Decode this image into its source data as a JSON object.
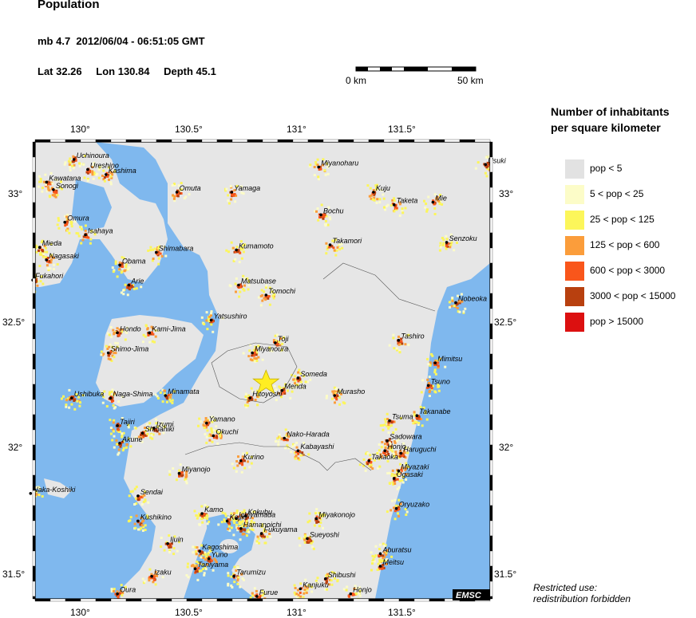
{
  "title": "Population",
  "event": {
    "magnitude": "mb 4.7",
    "datetime": "2012/06/04 - 06:51:05 GMT"
  },
  "location": {
    "lat": "Lat 32.26",
    "lon": "Lon 130.84",
    "depth": "Depth  45.1"
  },
  "scale": {
    "start": "0 km",
    "end": "50 km"
  },
  "legend": {
    "title_line1": "Number of inhabitants",
    "title_line2": "per square kilometer",
    "classes": [
      {
        "label": "pop < 5",
        "color": "#e2e2e2"
      },
      {
        "label": "5 < pop < 25",
        "color": "#fcfcc8"
      },
      {
        "label": "25 < pop < 125",
        "color": "#fcf65a"
      },
      {
        "label": "125 < pop < 600",
        "color": "#fb9d3b"
      },
      {
        "label": "600 < pop < 3000",
        "color": "#f9561b"
      },
      {
        "label": "3000 < pop < 15000",
        "color": "#b8400f"
      },
      {
        "label": "pop > 15000",
        "color": "#dc1010"
      }
    ]
  },
  "axes": {
    "lon_ticks": [
      "130°",
      "130.5°",
      "131°",
      "131.5°"
    ],
    "lat_ticks": [
      "33°",
      "32.5°",
      "32°",
      "31.5°"
    ]
  },
  "epicenter": {
    "lat": 32.26,
    "lon": 130.84,
    "color": "#ffee22"
  },
  "cities": [
    {
      "name": "Uchinoura",
      "lon": 130.0,
      "lat": 33.15
    },
    {
      "name": "Ureshino",
      "lon": 130.06,
      "lat": 33.11
    },
    {
      "name": "Kashima",
      "lon": 130.14,
      "lat": 33.09
    },
    {
      "name": "Kawatana",
      "lon": 129.88,
      "lat": 33.06
    },
    {
      "name": "Sonogi",
      "lon": 129.91,
      "lat": 33.03
    },
    {
      "name": "Omuta",
      "lon": 130.45,
      "lat": 33.02
    },
    {
      "name": "Yamaga",
      "lon": 130.69,
      "lat": 33.02
    },
    {
      "name": "Miyanoharu",
      "lon": 131.07,
      "lat": 33.12
    },
    {
      "name": "Kuju",
      "lon": 131.31,
      "lat": 33.02
    },
    {
      "name": "Taketa",
      "lon": 131.4,
      "lat": 32.97
    },
    {
      "name": "Mie",
      "lon": 131.57,
      "lat": 32.98
    },
    {
      "name": "Usuki",
      "lon": 131.8,
      "lat": 33.13
    },
    {
      "name": "Omura",
      "lon": 129.96,
      "lat": 32.9
    },
    {
      "name": "Isahaya",
      "lon": 130.05,
      "lat": 32.85
    },
    {
      "name": "Bochu",
      "lon": 131.08,
      "lat": 32.93
    },
    {
      "name": "Senzoku",
      "lon": 131.63,
      "lat": 32.82
    },
    {
      "name": "Mieda",
      "lon": 129.85,
      "lat": 32.8
    },
    {
      "name": "Takamori",
      "lon": 131.12,
      "lat": 32.81
    },
    {
      "name": "Shimabara",
      "lon": 130.36,
      "lat": 32.78
    },
    {
      "name": "Kumamoto",
      "lon": 130.71,
      "lat": 32.79
    },
    {
      "name": "Nagasaki",
      "lon": 129.88,
      "lat": 32.75
    },
    {
      "name": "Obama",
      "lon": 130.2,
      "lat": 32.73
    },
    {
      "name": "Arie",
      "lon": 130.24,
      "lat": 32.65
    },
    {
      "name": "Fukahori",
      "lon": 129.82,
      "lat": 32.67
    },
    {
      "name": "Matsubase",
      "lon": 130.72,
      "lat": 32.65
    },
    {
      "name": "Tomochi",
      "lon": 130.84,
      "lat": 32.61
    },
    {
      "name": "Nobeoka",
      "lon": 131.67,
      "lat": 32.58
    },
    {
      "name": "Yatsushiro",
      "lon": 130.6,
      "lat": 32.51
    },
    {
      "name": "Hondo",
      "lon": 130.19,
      "lat": 32.46
    },
    {
      "name": "Kami-Jima",
      "lon": 130.33,
      "lat": 32.46
    },
    {
      "name": "Tashiro",
      "lon": 131.42,
      "lat": 32.43
    },
    {
      "name": "Toji",
      "lon": 130.88,
      "lat": 32.42
    },
    {
      "name": "Miyanoura",
      "lon": 130.78,
      "lat": 32.38
    },
    {
      "name": "Shimo-Jima",
      "lon": 130.15,
      "lat": 32.38
    },
    {
      "name": "Mimitsu",
      "lon": 131.58,
      "lat": 32.34
    },
    {
      "name": "Someda",
      "lon": 130.98,
      "lat": 32.28
    },
    {
      "name": "Menda",
      "lon": 130.91,
      "lat": 32.23
    },
    {
      "name": "Hitoyoshi",
      "lon": 130.77,
      "lat": 32.2
    },
    {
      "name": "Murasho",
      "lon": 131.14,
      "lat": 32.21
    },
    {
      "name": "Tsuno",
      "lon": 131.55,
      "lat": 32.25
    },
    {
      "name": "Ushibuka",
      "lon": 129.99,
      "lat": 32.2
    },
    {
      "name": "Naga-Shima",
      "lon": 130.16,
      "lat": 32.2
    },
    {
      "name": "Minamata",
      "lon": 130.4,
      "lat": 32.21
    },
    {
      "name": "Takanabe",
      "lon": 131.5,
      "lat": 32.13
    },
    {
      "name": "Tsuma",
      "lon": 131.38,
      "lat": 32.11
    },
    {
      "name": "Tajiri",
      "lon": 130.19,
      "lat": 32.09
    },
    {
      "name": "Izumi",
      "lon": 130.35,
      "lat": 32.08
    },
    {
      "name": "Shibahiki",
      "lon": 130.3,
      "lat": 32.06
    },
    {
      "name": "Yamano",
      "lon": 130.58,
      "lat": 32.1
    },
    {
      "name": "Okuchi",
      "lon": 130.61,
      "lat": 32.05
    },
    {
      "name": "Nako-Harada",
      "lon": 130.92,
      "lat": 32.04
    },
    {
      "name": "Sadowara",
      "lon": 131.37,
      "lat": 32.03
    },
    {
      "name": "Akune",
      "lon": 130.2,
      "lat": 32.02
    },
    {
      "name": "Kabayashi",
      "lon": 130.98,
      "lat": 31.99
    },
    {
      "name": "Honjo",
      "lon": 131.36,
      "lat": 31.99
    },
    {
      "name": "Haruguchi",
      "lon": 131.43,
      "lat": 31.98
    },
    {
      "name": "Takaoka",
      "lon": 131.29,
      "lat": 31.95
    },
    {
      "name": "Kurino",
      "lon": 130.73,
      "lat": 31.95
    },
    {
      "name": "Miyazaki",
      "lon": 131.42,
      "lat": 31.91
    },
    {
      "name": "Ogasaki",
      "lon": 131.4,
      "lat": 31.88
    },
    {
      "name": "Miyanojo",
      "lon": 130.46,
      "lat": 31.9
    },
    {
      "name": "Naka-Koshiki",
      "lon": 129.81,
      "lat": 31.82
    },
    {
      "name": "Sendai",
      "lon": 130.28,
      "lat": 31.81
    },
    {
      "name": "Oryuzako",
      "lon": 131.41,
      "lat": 31.76
    },
    {
      "name": "Kamo",
      "lon": 130.56,
      "lat": 31.74
    },
    {
      "name": "Ichiyamada",
      "lon": 130.71,
      "lat": 31.72
    },
    {
      "name": "Kokubu",
      "lon": 130.75,
      "lat": 31.73
    },
    {
      "name": "Kajiki",
      "lon": 130.67,
      "lat": 31.71
    },
    {
      "name": "Miyakonojo",
      "lon": 131.06,
      "lat": 31.72
    },
    {
      "name": "Hamanoichi",
      "lon": 130.73,
      "lat": 31.68
    },
    {
      "name": "Fukuyama",
      "lon": 130.82,
      "lat": 31.66
    },
    {
      "name": "Kushikino",
      "lon": 130.28,
      "lat": 31.71
    },
    {
      "name": "Sueyoshi",
      "lon": 131.02,
      "lat": 31.64
    },
    {
      "name": "Aburatsu",
      "lon": 131.34,
      "lat": 31.58
    },
    {
      "name": "Ijuin",
      "lon": 130.41,
      "lat": 31.62
    },
    {
      "name": "Kagoshima",
      "lon": 130.55,
      "lat": 31.59
    },
    {
      "name": "Yuno",
      "lon": 130.59,
      "lat": 31.56
    },
    {
      "name": "Meitsu",
      "lon": 131.34,
      "lat": 31.53
    },
    {
      "name": "Taniyama",
      "lon": 130.53,
      "lat": 31.52
    },
    {
      "name": "Tarumizu",
      "lon": 130.7,
      "lat": 31.49
    },
    {
      "name": "Izaku",
      "lon": 130.34,
      "lat": 31.49
    },
    {
      "name": "Shibushi",
      "lon": 131.1,
      "lat": 31.48
    },
    {
      "name": "Kanjuku",
      "lon": 130.99,
      "lat": 31.44
    },
    {
      "name": "Honjo",
      "lon": 131.21,
      "lat": 31.42
    },
    {
      "name": "Oura",
      "lon": 130.19,
      "lat": 31.42
    },
    {
      "name": "Furue",
      "lon": 130.8,
      "lat": 31.41
    }
  ],
  "badge": "EMSC",
  "footnote": {
    "line1": "Restricted use:",
    "line2": "redistribution forbidden"
  }
}
